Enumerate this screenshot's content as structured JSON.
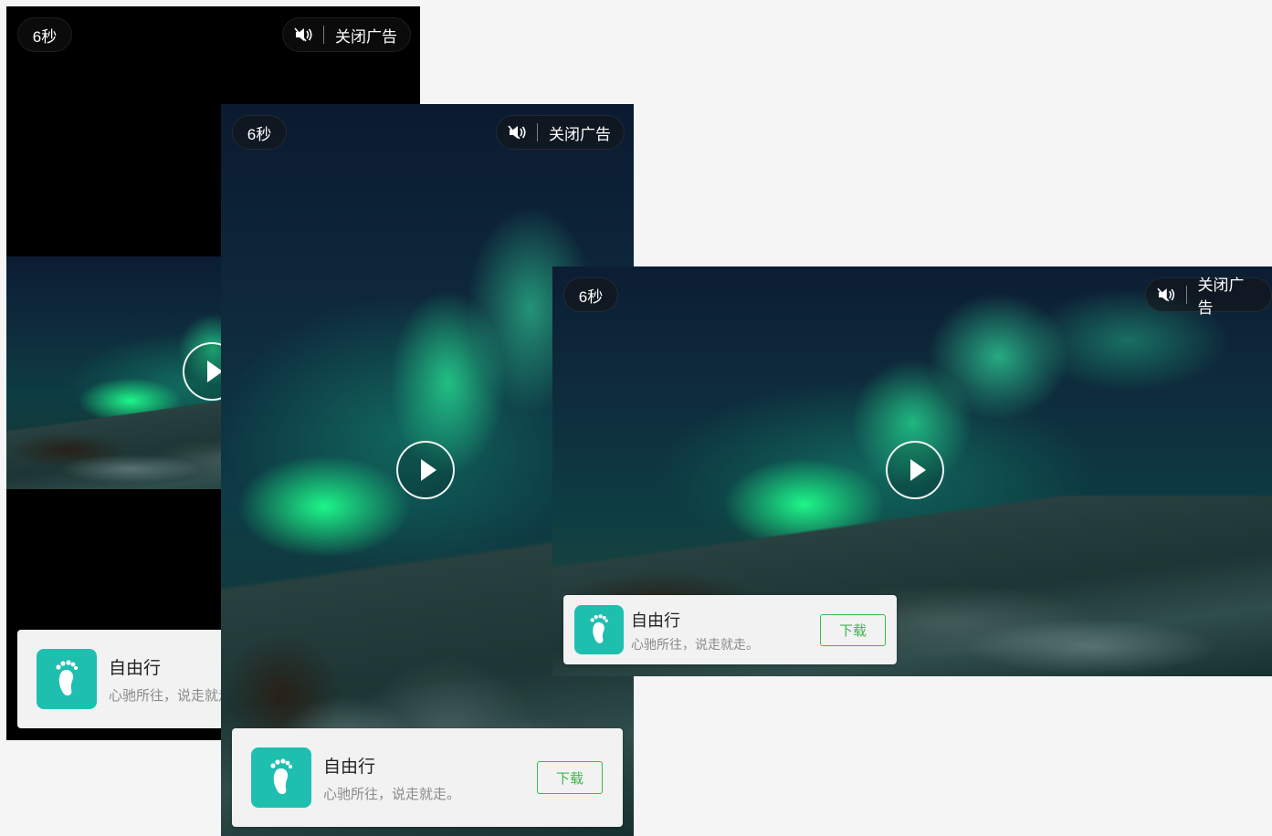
{
  "ads": [
    {
      "id": "portrait-letterbox",
      "countdown": "6秒",
      "close_label": "关闭广告",
      "app": {
        "name": "自由行",
        "description": "心驰所往，说走就走。"
      },
      "icons": {
        "mute": "mute-icon",
        "play": "play-icon",
        "app": "footprint-icon"
      }
    },
    {
      "id": "portrait-full",
      "countdown": "6秒",
      "close_label": "关闭广告",
      "app": {
        "name": "自由行",
        "description": "心驰所往，说走就走。",
        "download_label": "下载"
      },
      "icons": {
        "mute": "mute-icon",
        "play": "play-icon",
        "app": "footprint-icon"
      }
    },
    {
      "id": "landscape",
      "countdown": "6秒",
      "close_label": "关闭广告",
      "app": {
        "name": "自由行",
        "description": "心驰所往，说走就走。",
        "download_label": "下载"
      },
      "icons": {
        "mute": "mute-icon",
        "play": "play-icon",
        "app": "footprint-icon"
      }
    }
  ],
  "colors": {
    "accent_green": "#3cb84a",
    "app_icon_bg": "#1fbfb0",
    "page_bg": "#f5f5f5"
  }
}
